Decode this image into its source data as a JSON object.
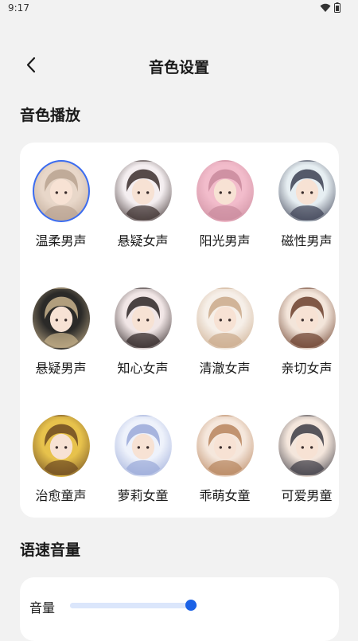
{
  "status": {
    "time": "9:17"
  },
  "header": {
    "title": "音色设置",
    "back_icon": "chevron-left-icon"
  },
  "sections": {
    "voice_title": "音色播放",
    "speed_title": "语速音量"
  },
  "voices": [
    {
      "label": "温柔男声",
      "selected": true,
      "c1": "#e8d7c9",
      "c2": "#b9a391"
    },
    {
      "label": "悬疑女声",
      "selected": false,
      "c1": "#f4eef0",
      "c2": "#3a2d2c"
    },
    {
      "label": "阳光男声",
      "selected": false,
      "c1": "#f2bccb",
      "c2": "#c98a9c"
    },
    {
      "label": "磁性男声",
      "selected": false,
      "c1": "#e6eef2",
      "c2": "#3b3f52"
    },
    {
      "label": "悬疑男声",
      "selected": false,
      "c1": "#2b2a28",
      "c2": "#c9b38c"
    },
    {
      "label": "知心女声",
      "selected": false,
      "c1": "#f1e6e6",
      "c2": "#2d2424"
    },
    {
      "label": "清澈女声",
      "selected": false,
      "c1": "#f6efe8",
      "c2": "#caa98a"
    },
    {
      "label": "亲切女声",
      "selected": false,
      "c1": "#f3e5da",
      "c2": "#6b3f2c"
    },
    {
      "label": "治愈童声",
      "selected": false,
      "c1": "#e7c24c",
      "c2": "#6d4a21"
    },
    {
      "label": "萝莉女童",
      "selected": false,
      "c1": "#eef2fb",
      "c2": "#9aa9d8"
    },
    {
      "label": "乖萌女童",
      "selected": false,
      "c1": "#f5e7dc",
      "c2": "#b7845d"
    },
    {
      "label": "可爱男童",
      "selected": false,
      "c1": "#f4e6dc",
      "c2": "#3c3b44"
    }
  ],
  "volume": {
    "label": "音量",
    "value": 0.95
  },
  "colors": {
    "accent": "#1b62e6",
    "track": "#dbe6fb",
    "selected_ring": "#3b6cf0"
  }
}
